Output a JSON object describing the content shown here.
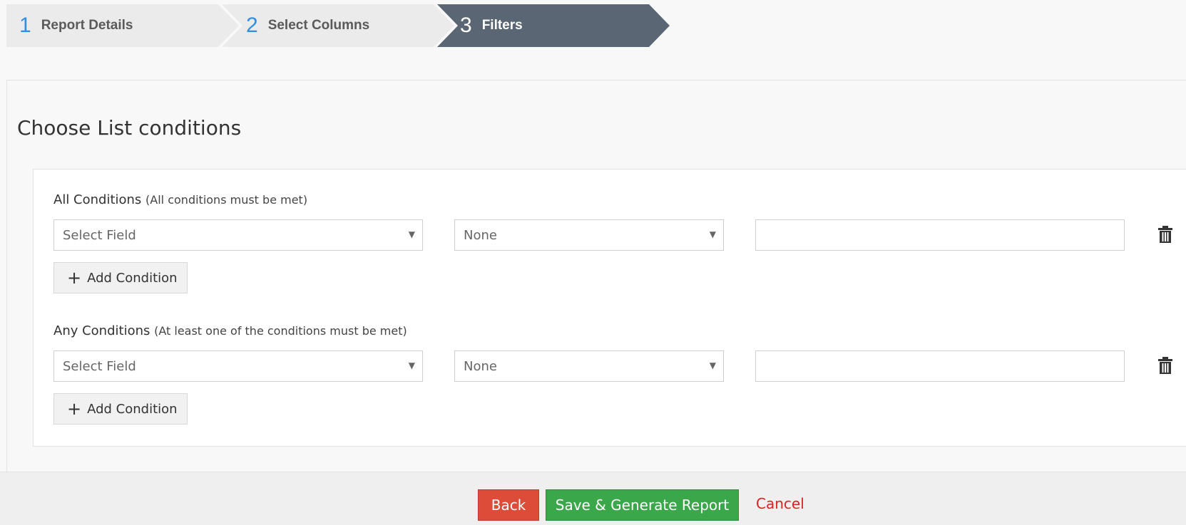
{
  "wizard": {
    "steps": [
      {
        "number": "1",
        "label": "Report Details"
      },
      {
        "number": "2",
        "label": "Select Columns"
      },
      {
        "number": "3",
        "label": "Filters"
      }
    ],
    "active_step": "3"
  },
  "main": {
    "title": "Choose List conditions",
    "all_conditions": {
      "title": "All Conditions",
      "hint": "(All conditions must be met)",
      "field_placeholder": "Select Field",
      "operator_value": "None",
      "value": "",
      "add_label": "Add Condition"
    },
    "any_conditions": {
      "title": "Any Conditions",
      "hint": "(At least one of the conditions must be met)",
      "field_placeholder": "Select Field",
      "operator_value": "None",
      "value": "",
      "add_label": "Add Condition"
    }
  },
  "footer": {
    "back_label": "Back",
    "save_label": "Save & Generate Report",
    "cancel_label": "Cancel"
  },
  "colors": {
    "step_inactive": "#ebebeb",
    "step_active": "#5a6673",
    "step_number": "#2f8ee8",
    "back": "#dd4b39",
    "save": "#3aa84a",
    "cancel": "#e02020"
  },
  "icons": {
    "caret": "caret-down-icon",
    "delete": "trash-icon",
    "add": "plus-icon"
  }
}
